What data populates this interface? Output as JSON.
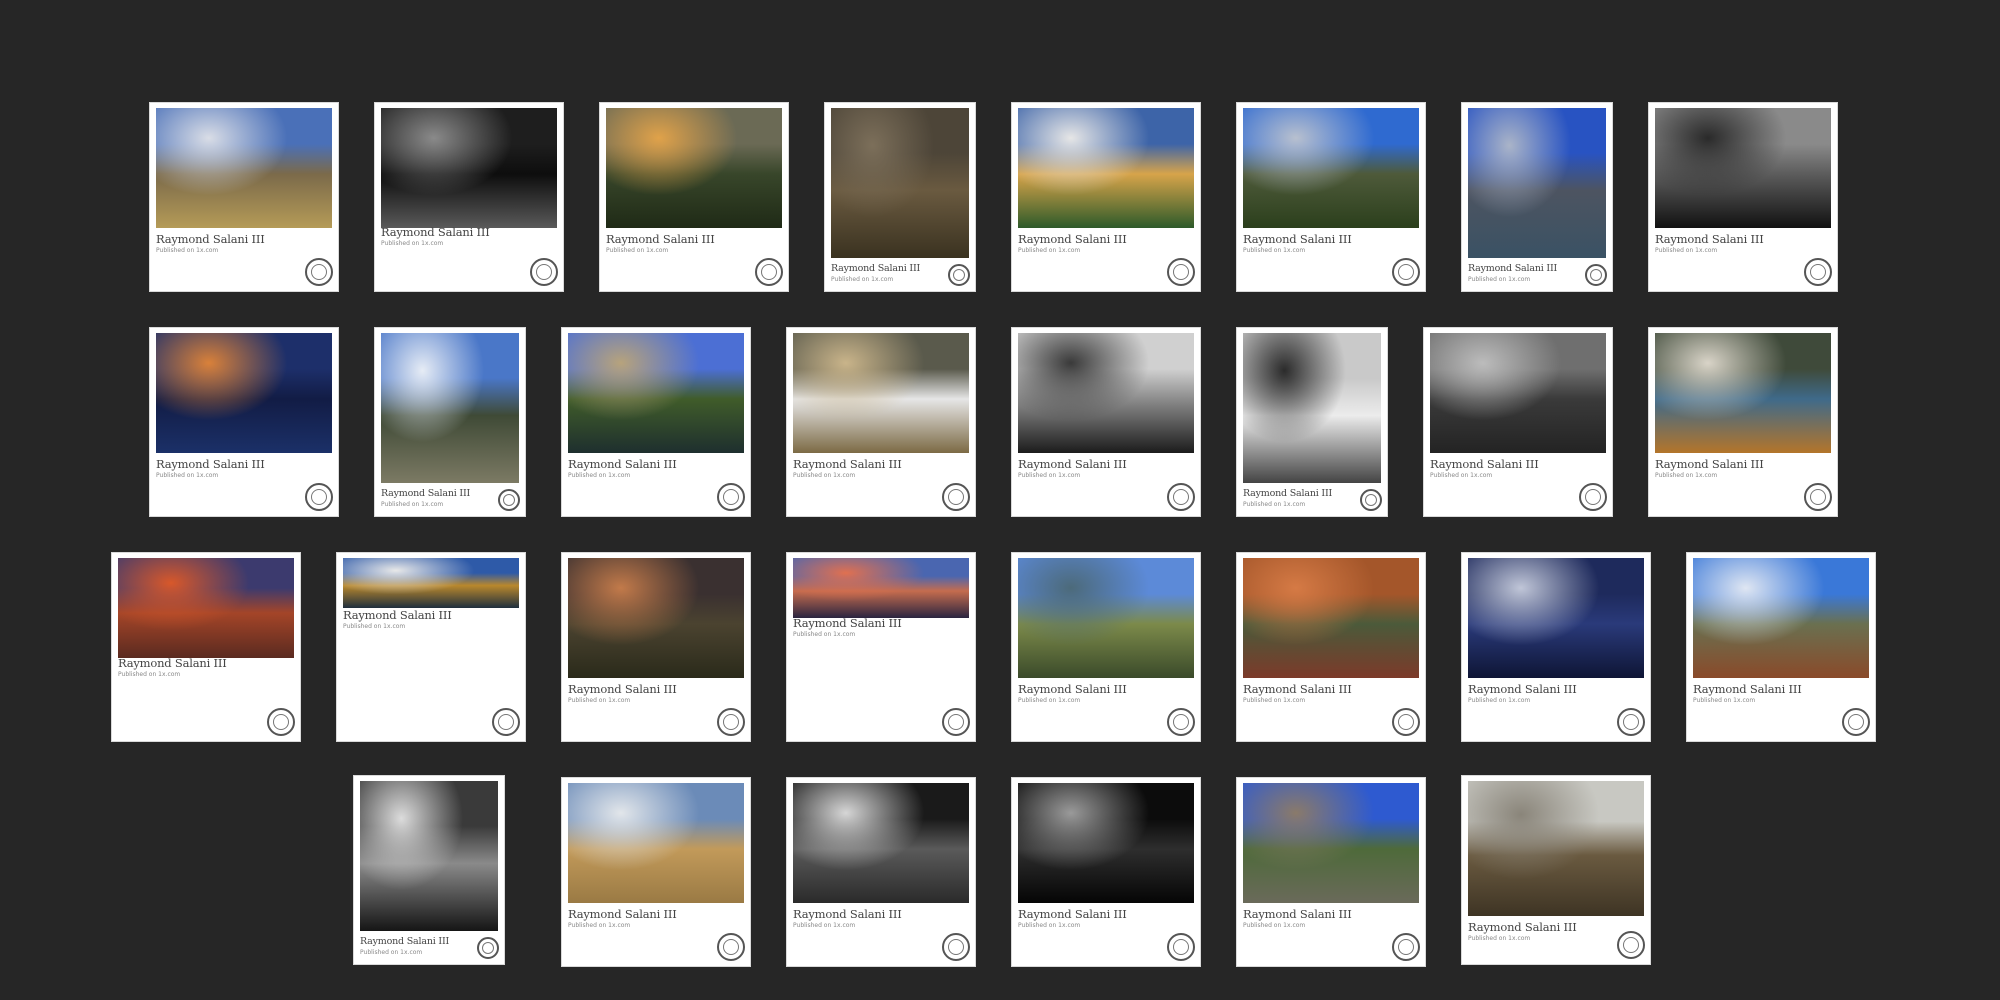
{
  "gallery": {
    "cards": [
      {
        "author": "Raymond Salani III",
        "caption": "Published on 1x.com",
        "colors": [
          "#4a70b8",
          "#d9dde6",
          "#7b6a4a",
          "#b59b57"
        ],
        "bw": false
      },
      {
        "author": "Raymond Salani III",
        "caption": "Published on 1x.com",
        "colors": [
          "#1e1e1e",
          "#8a8a8a",
          "#0d0d0d",
          "#5a5a5a"
        ],
        "bw": true
      },
      {
        "author": "Raymond Salani III",
        "caption": "Published on 1x.com",
        "colors": [
          "#6b6a55",
          "#e0a24a",
          "#38462a",
          "#1f2a16"
        ],
        "bw": false
      },
      {
        "author": "Raymond Salani III",
        "caption": "Published on 1x.com",
        "colors": [
          "#4d4538",
          "#7c6f5a",
          "#6a5a40",
          "#3a3220"
        ],
        "bw": false
      },
      {
        "author": "Raymond Salani III",
        "caption": "Published on 1x.com",
        "colors": [
          "#3d64a8",
          "#e6e6e6",
          "#d7a44a",
          "#2d5a2a"
        ],
        "bw": false
      },
      {
        "author": "Raymond Salani III",
        "caption": "Published on 1x.com",
        "colors": [
          "#2f6ad0",
          "#b8c0cf",
          "#4e5a3a",
          "#2b3f1c"
        ],
        "bw": false
      },
      {
        "author": "Raymond Salani III",
        "caption": "Published on 1x.com",
        "colors": [
          "#2853c2",
          "#aab4c8",
          "#4d5461",
          "#3a5264"
        ],
        "bw": false
      },
      {
        "author": "Raymond Salani III",
        "caption": "Published on 1x.com",
        "colors": [
          "#8a8a8a",
          "#2a2a2a",
          "#5c5c5c",
          "#111111"
        ],
        "bw": true
      },
      {
        "author": "Raymond Salani III",
        "caption": "Published on 1x.com",
        "colors": [
          "#1d2f6a",
          "#d9813a",
          "#121c45",
          "#1b3068"
        ],
        "bw": false
      },
      {
        "author": "Raymond Salani III",
        "caption": "Published on 1x.com",
        "colors": [
          "#4a77c8",
          "#e6ecf5",
          "#3f4a36",
          "#7c7a64"
        ],
        "bw": false
      },
      {
        "author": "Raymond Salani III",
        "caption": "Published on 1x.com",
        "colors": [
          "#4c6fd4",
          "#b7a37c",
          "#405c2a",
          "#1e2f2e"
        ],
        "bw": false
      },
      {
        "author": "Raymond Salani III",
        "caption": "Published on 1x.com",
        "colors": [
          "#5a5a4c",
          "#c9b48a",
          "#e6e6e6",
          "#7c6a44"
        ],
        "bw": false
      },
      {
        "author": "Raymond Salani III",
        "caption": "Published on 1x.com",
        "colors": [
          "#d0d0d0",
          "#3a3a3a",
          "#8c8c8c",
          "#1c1c1c"
        ],
        "bw": true
      },
      {
        "author": "Raymond Salani III",
        "caption": "Published on 1x.com",
        "colors": [
          "#c9c9c9",
          "#2b2b2b",
          "#ececec",
          "#444444"
        ],
        "bw": true
      },
      {
        "author": "Raymond Salani III",
        "caption": "Published on 1x.com",
        "colors": [
          "#6f6f6f",
          "#bcbcbc",
          "#3a3a3a",
          "#232323"
        ],
        "bw": true
      },
      {
        "author": "Raymond Salani III",
        "caption": "Published on 1x.com",
        "colors": [
          "#3f4a3a",
          "#d9d4c8",
          "#3f6a8a",
          "#b4752a"
        ],
        "bw": false
      },
      {
        "author": "Raymond Salani III",
        "caption": "Published on 1x.com",
        "colors": [
          "#3c3a6e",
          "#d8582a",
          "#a44528",
          "#5a2a20"
        ],
        "bw": false
      },
      {
        "author": "Raymond Salani III",
        "caption": "Published on 1x.com",
        "colors": [
          "#2e5aa8",
          "#e8e8e8",
          "#b9882c",
          "#1f2f3e"
        ],
        "bw": false
      },
      {
        "author": "Raymond Salani III",
        "caption": "Published on 1x.com",
        "colors": [
          "#3a3030",
          "#c27a4a",
          "#4b4330",
          "#2a2a1a"
        ],
        "bw": false
      },
      {
        "author": "Raymond Salani III",
        "caption": "Published on 1x.com",
        "colors": [
          "#4a66b0",
          "#e07050",
          "#c56c4e",
          "#2a2440"
        ],
        "bw": false
      },
      {
        "author": "Raymond Salani III",
        "caption": "Published on 1x.com",
        "colors": [
          "#5c8ad8",
          "#4c6a7a",
          "#7c8a4a",
          "#3a4a2a"
        ],
        "bw": false
      },
      {
        "author": "Raymond Salani III",
        "caption": "Published on 1x.com",
        "colors": [
          "#a4562a",
          "#d57a45",
          "#4b5a3a",
          "#7c3a2a"
        ],
        "bw": false
      },
      {
        "author": "Raymond Salani III",
        "caption": "Published on 1x.com",
        "colors": [
          "#1e2a5c",
          "#c0c6d8",
          "#2a3a7a",
          "#0e1535"
        ],
        "bw": false
      },
      {
        "author": "Raymond Salani III",
        "caption": "Published on 1x.com",
        "colors": [
          "#3a78d8",
          "#dfe6f2",
          "#6a7050",
          "#8a4a2a"
        ],
        "bw": false
      },
      {
        "author": "Raymond Salani III",
        "caption": "Published on 1x.com",
        "colors": [
          "#3a3a3a",
          "#dcdcdc",
          "#8a8a8a",
          "#151515"
        ],
        "bw": true
      },
      {
        "author": "Raymond Salani III",
        "caption": "Published on 1x.com",
        "colors": [
          "#6b8bb8",
          "#e2e6ea",
          "#c29a5a",
          "#9a7a44"
        ],
        "bw": false
      },
      {
        "author": "Raymond Salani III",
        "caption": "Published on 1x.com",
        "colors": [
          "#1a1a1a",
          "#d6d6d6",
          "#5a5a5a",
          "#2a2a2a"
        ],
        "bw": true
      },
      {
        "author": "Raymond Salani III",
        "caption": "Published on 1x.com",
        "colors": [
          "#0c0c0c",
          "#9a9a9a",
          "#2e2e2e",
          "#050505"
        ],
        "bw": true
      },
      {
        "author": "Raymond Salani III",
        "caption": "Published on 1x.com",
        "colors": [
          "#2e5ad0",
          "#8a7a6a",
          "#4e6a3a",
          "#6a6a5a"
        ],
        "bw": false
      },
      {
        "author": "Raymond Salani III",
        "caption": "Published on 1x.com",
        "colors": [
          "#c8c8c2",
          "#8a857a",
          "#6a5a40",
          "#3e3424"
        ],
        "bw": false
      }
    ]
  }
}
